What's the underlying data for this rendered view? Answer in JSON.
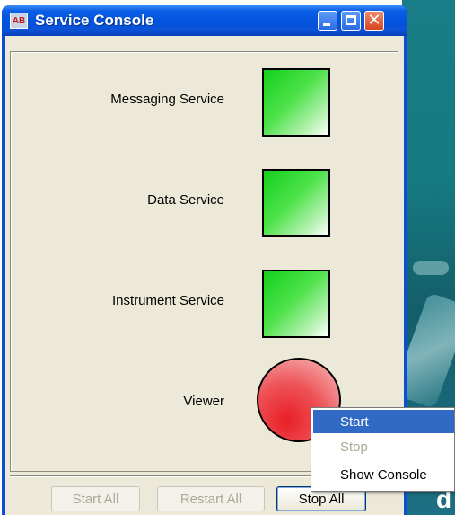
{
  "window": {
    "title": "Service Console",
    "icon_text": "AB",
    "buttons": {
      "minimize": "minimize-icon",
      "maximize": "maximize-icon",
      "close": "close-icon",
      "close_glyph": "✕"
    }
  },
  "services": [
    {
      "label": "Messaging Service",
      "status": "running",
      "color": "#2fd82f"
    },
    {
      "label": "Data Service",
      "status": "running",
      "color": "#2fd82f"
    },
    {
      "label": "Instrument Service",
      "status": "running",
      "color": "#2fd82f"
    },
    {
      "label": "Viewer",
      "status": "stopped",
      "color": "#e9262c"
    }
  ],
  "actions": {
    "start_all": "Start All",
    "restart_all": "Restart All",
    "stop_all": "Stop All"
  },
  "context_menu": {
    "items": [
      {
        "label": "Start",
        "state": "highlighted"
      },
      {
        "label": "Stop",
        "state": "disabled"
      },
      {
        "label": "Show Console",
        "state": "enabled"
      }
    ]
  },
  "colors": {
    "titlebar": "#0453de",
    "client_bg": "#ece9d8",
    "menu_highlight": "#316ac5",
    "running": "#2fd82f",
    "stopped": "#e9262c"
  }
}
